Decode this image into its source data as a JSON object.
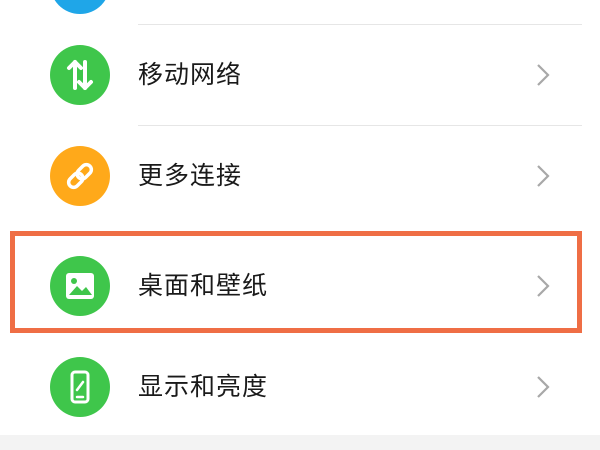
{
  "colors": {
    "green": "#3fc64b",
    "orange": "#ffa91a",
    "blue": "#1fa6e8",
    "highlight": "#ef6e45"
  },
  "settings": {
    "items": [
      {
        "label": "移动网络",
        "icon": "mobile-data-arrows-icon"
      },
      {
        "label": "更多连接",
        "icon": "link-icon"
      },
      {
        "label": "桌面和壁纸",
        "icon": "wallpaper-image-icon"
      },
      {
        "label": "显示和亮度",
        "icon": "phone-display-icon"
      }
    ]
  }
}
